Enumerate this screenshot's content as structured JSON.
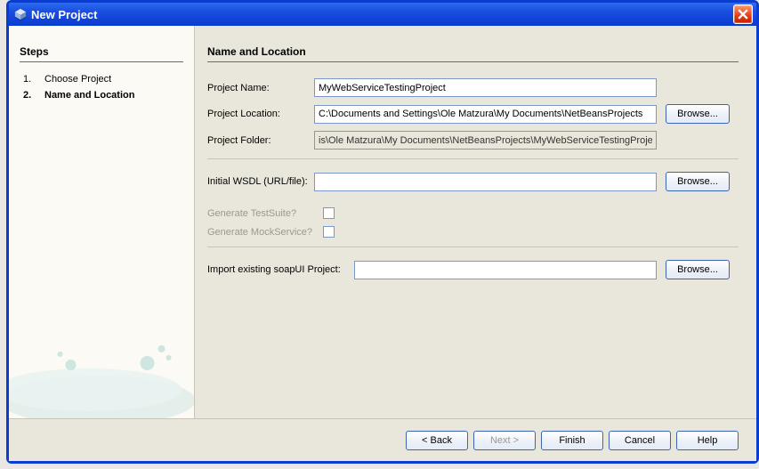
{
  "window": {
    "title": "New Project"
  },
  "sidebar": {
    "heading": "Steps",
    "steps": [
      {
        "num": "1.",
        "label": "Choose Project"
      },
      {
        "num": "2.",
        "label": "Name and Location"
      }
    ]
  },
  "main": {
    "heading": "Name and Location",
    "projectName": {
      "label": "Project Name:",
      "value": "MyWebServiceTestingProject"
    },
    "projectLocation": {
      "label": "Project Location:",
      "value": "C:\\Documents and Settings\\Ole Matzura\\My Documents\\NetBeansProjects",
      "browse": "Browse..."
    },
    "projectFolder": {
      "label": "Project Folder:",
      "value": "is\\Ole Matzura\\My Documents\\NetBeansProjects\\MyWebServiceTestingProject"
    },
    "initialWsdl": {
      "label": "Initial WSDL (URL/file):",
      "value": "",
      "browse": "Browse..."
    },
    "genTestSuite": {
      "label": "Generate TestSuite?"
    },
    "genMockService": {
      "label": "Generate MockService?"
    },
    "importExisting": {
      "label": "Import existing soapUI Project:",
      "value": "",
      "browse": "Browse..."
    }
  },
  "footer": {
    "back": "< Back",
    "next": "Next >",
    "finish": "Finish",
    "cancel": "Cancel",
    "help": "Help"
  }
}
